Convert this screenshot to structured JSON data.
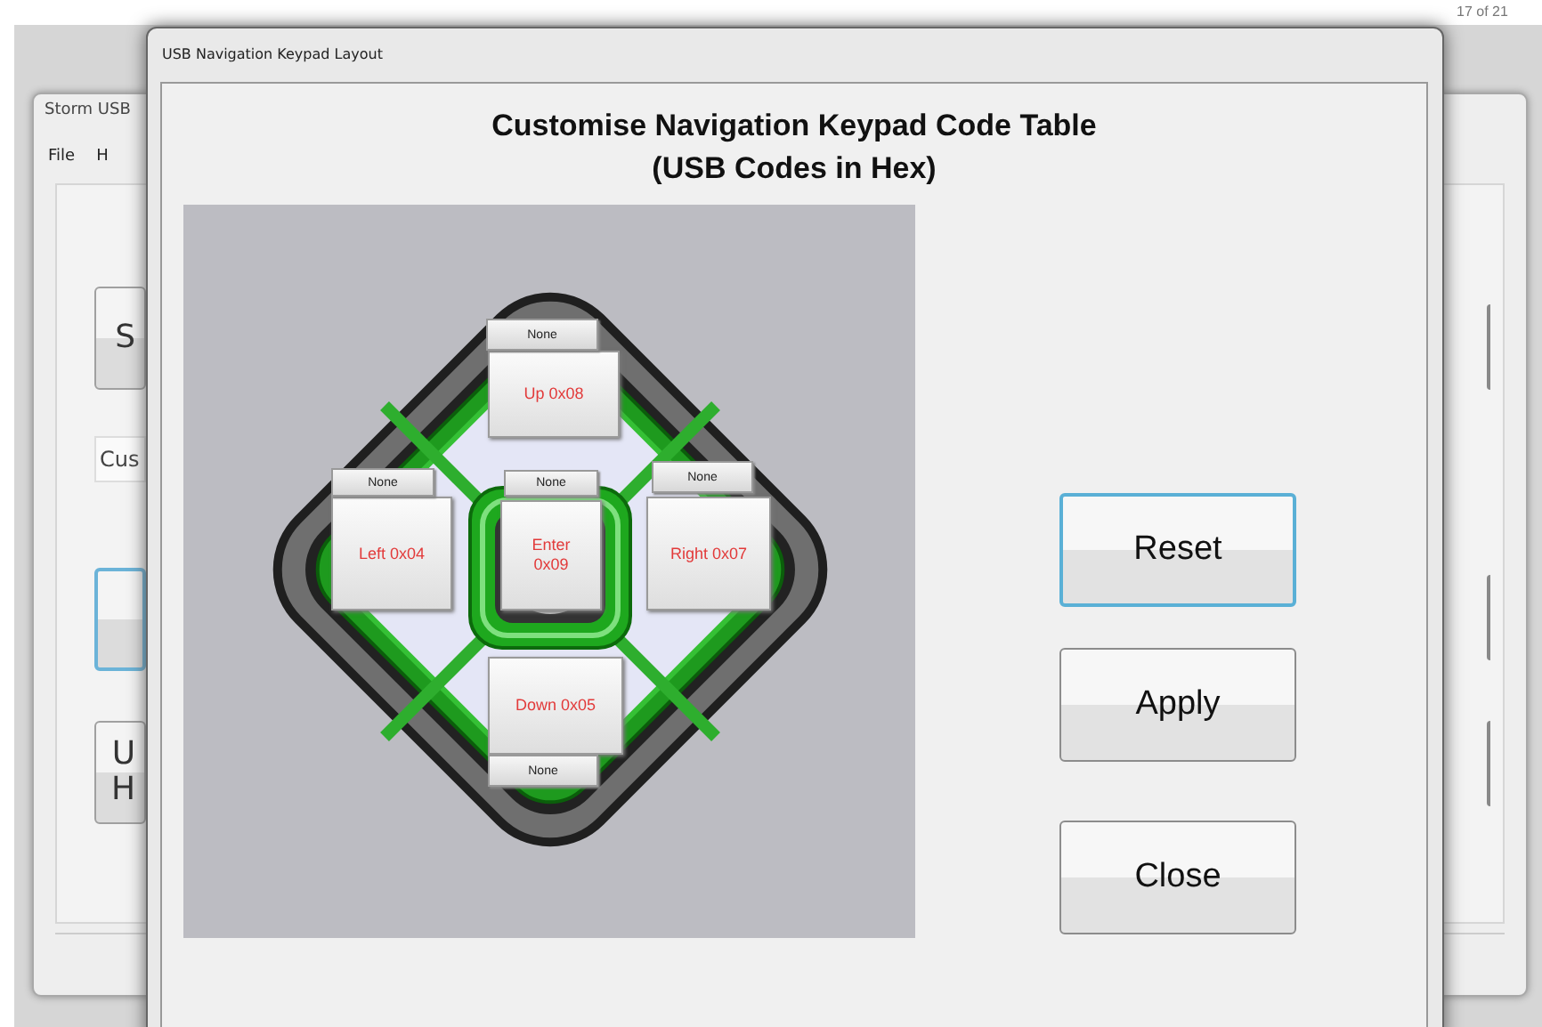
{
  "page_number": "17 of 21",
  "background_window": {
    "title": "Storm USB",
    "menu": [
      "File",
      "H"
    ],
    "field_value": "Cus",
    "buttons": [
      {
        "lines": [
          "S"
        ],
        "focused": false
      },
      {
        "focused": true
      },
      {
        "lines": [
          "U",
          "H"
        ],
        "focused": false
      }
    ]
  },
  "dialog": {
    "title": "USB Navigation Keypad Layout",
    "heading": [
      "Customise Navigation Keypad Code Table",
      "(USB Codes in Hex)"
    ],
    "keys": [
      {
        "kind": "up",
        "label": "Up 0x08",
        "modifier": "None"
      },
      {
        "kind": "left",
        "label": "Left 0x04",
        "modifier": "None"
      },
      {
        "kind": "enter",
        "label": "Enter\n0x09",
        "modifier": "None"
      },
      {
        "kind": "right",
        "label": "Right 0x07",
        "modifier": "None"
      },
      {
        "kind": "down",
        "label": "Down 0x05",
        "modifier": "None"
      }
    ],
    "buttons": [
      {
        "label": "Reset",
        "focused": true
      },
      {
        "label": "Apply",
        "focused": false
      },
      {
        "label": "Close",
        "focused": false
      }
    ]
  }
}
